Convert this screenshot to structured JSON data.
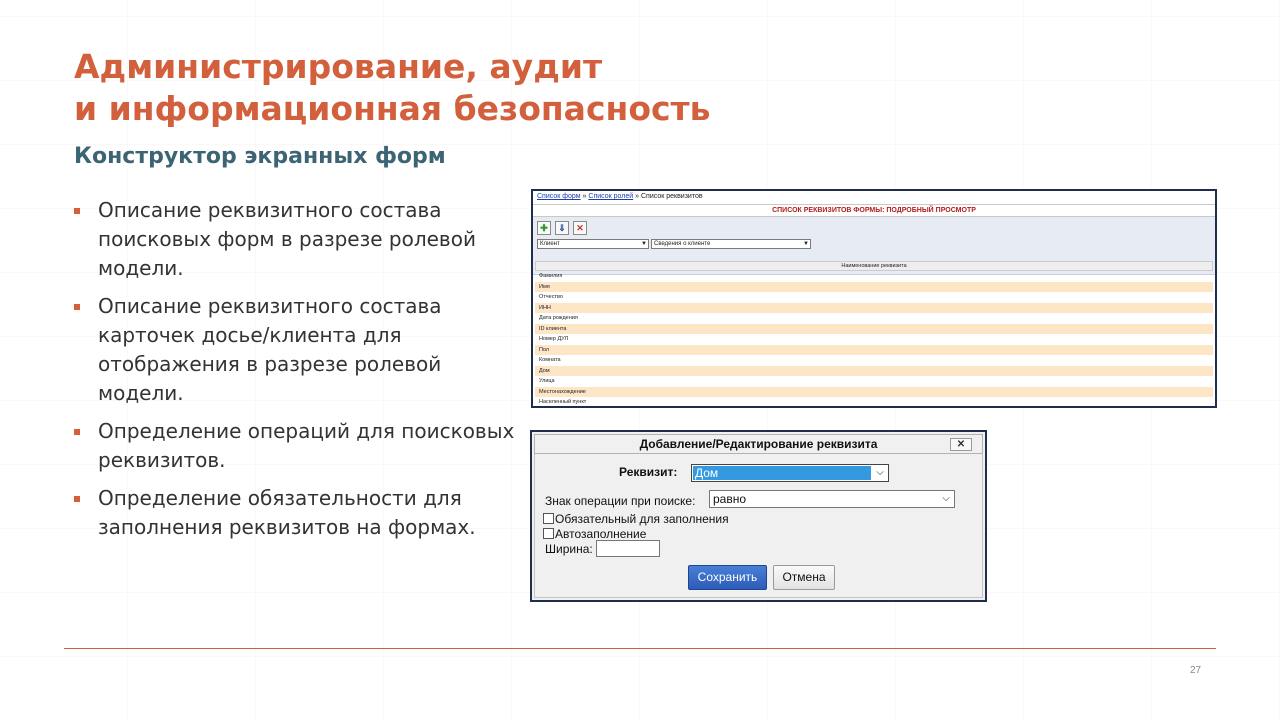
{
  "slide": {
    "title_line1": "Администрирование, аудит",
    "title_line2": "и информационная безопасность",
    "subtitle": "Конструктор экранных форм",
    "bullets": [
      "Описание реквизитного состава поисковых форм в разрезе ролевой модели.",
      "Описание реквизитного состава карточек досье/клиента для отображения в разрезе ролевой модели.",
      "Определение операций для поисковых реквизитов.",
      "Определение обязательности для заполнения реквизитов на формах."
    ],
    "page_number": "27",
    "accent_color": "#d2603c",
    "subtitle_color": "#3c6474"
  },
  "requisites_list": {
    "breadcrumb": {
      "link1": "Список форм",
      "link2": "Список ролей",
      "current": "Список реквизитов",
      "separator": "»"
    },
    "header": "СПИСОК РЕКВИЗИТОВ ФОРМЫ: ПОДРОБНЫЙ ПРОСМОТР",
    "toolbar": {
      "add_icon": "plus-icon",
      "move_down_icon": "arrow-down-icon",
      "delete_icon": "delete-icon",
      "delete_glyph": "✕",
      "select1_value": "Клиент",
      "select2_value": "Сведения о клиенте"
    },
    "column_header": "Наименование реквизита",
    "rows": [
      "Фамилия",
      "Имя",
      "Отчество",
      "ИНН",
      "Дата рождения",
      "ID клиента",
      "Номер ДУЛ",
      "Пол",
      "Комната",
      "Дом",
      "Улица",
      "Местонахождение",
      "Населенный пункт"
    ],
    "row_alt_color": "#fde6c6"
  },
  "dialog": {
    "title": "Добавление/Редактирование реквизита",
    "close_glyph": "✕",
    "requisite_label": "Реквизит:",
    "requisite_value": "Дом",
    "operation_label": "Знак операции при поиске:",
    "operation_value": "равно",
    "required_label": "Обязательный для заполнения",
    "autofill_label": "Автозаполнение",
    "width_label": "Ширина:",
    "width_value": "",
    "save_label": "Сохранить",
    "cancel_label": "Отмена",
    "selected_color": "#3399e0",
    "save_color": "#2c5cb8"
  }
}
